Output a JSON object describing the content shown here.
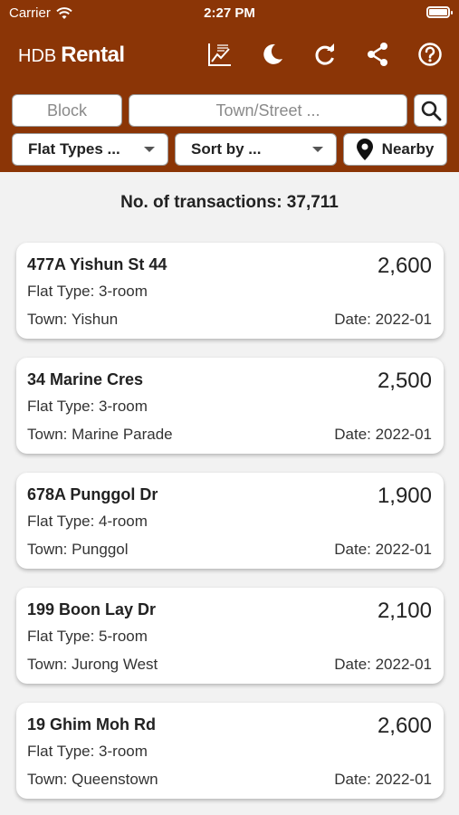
{
  "status_bar": {
    "carrier": "Carrier",
    "time": "2:27 PM"
  },
  "app": {
    "title_prefix": "HDB",
    "title_main": "Rental"
  },
  "toolbar_icons": [
    "chart-icon",
    "moon-icon",
    "refresh-icon",
    "share-icon",
    "help-icon"
  ],
  "search": {
    "block_placeholder": "Block",
    "street_placeholder": "Town/Street ..."
  },
  "filters": {
    "flat_types_label": "Flat Types ...",
    "sort_label": "Sort by ...",
    "nearby_label": "Nearby"
  },
  "summary": {
    "transactions_text": "No. of transactions: 37,711"
  },
  "colors": {
    "header": "#8b3506",
    "background": "#f2f2f2"
  },
  "listings": [
    {
      "address": "477A Yishun St 44",
      "price": "2,600",
      "flat_type": "Flat Type: 3-room",
      "town": "Town: Yishun",
      "date": "Date: 2022-01"
    },
    {
      "address": "34 Marine Cres",
      "price": "2,500",
      "flat_type": "Flat Type: 3-room",
      "town": "Town: Marine Parade",
      "date": "Date: 2022-01"
    },
    {
      "address": "678A Punggol Dr",
      "price": "1,900",
      "flat_type": "Flat Type: 4-room",
      "town": "Town: Punggol",
      "date": "Date: 2022-01"
    },
    {
      "address": "199 Boon Lay Dr",
      "price": "2,100",
      "flat_type": "Flat Type: 5-room",
      "town": "Town: Jurong West",
      "date": "Date: 2022-01"
    },
    {
      "address": "19 Ghim Moh Rd",
      "price": "2,600",
      "flat_type": "Flat Type: 3-room",
      "town": "Town: Queenstown",
      "date": "Date: 2022-01"
    }
  ]
}
